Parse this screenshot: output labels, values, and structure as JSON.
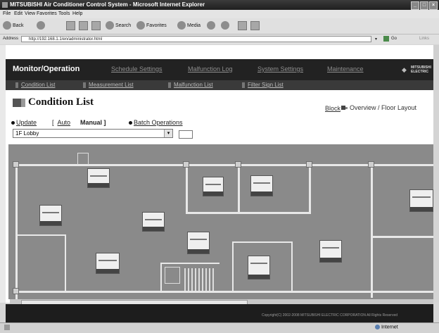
{
  "window": {
    "title": "MITSUBISHI Air Conditioner Control System - Microsoft Internet Explorer"
  },
  "menu": [
    "File",
    "Edit",
    "View",
    "Favorites",
    "Tools",
    "Help"
  ],
  "toolbar": {
    "back": "Back",
    "search": "Search",
    "favorites": "Favorites",
    "media": "Media"
  },
  "address": {
    "label": "Address",
    "url": "http://192.168.1.1/en/administrator.html",
    "go": "Go",
    "links": "Links"
  },
  "nav": {
    "active": "Monitor/Operation",
    "items": [
      "Schedule Settings",
      "Malfunction Log",
      "System Settings",
      "Maintenance"
    ],
    "sub": [
      "Condition List",
      "Measurement List",
      "Malfunction List",
      "Filter Sign List"
    ]
  },
  "logo": {
    "name": "MITSUBISHI ELECTRIC"
  },
  "page": {
    "title": "Condition List",
    "view_block": "Block",
    "view_overview": "Overview / Floor Layout",
    "update": "Update",
    "auto": "Auto",
    "manual": "Manual",
    "batch": "Batch Operations",
    "floor_select": "1F Lobby"
  },
  "footer": {
    "copyright": "Copyright(C) 2002-2008 MITSUBISHI ELECTRIC CORPORATION All Rights Reserved"
  },
  "status": {
    "zone": "Internet"
  },
  "colors": {
    "nav_bg": "#222222",
    "floor_bg": "#8a8a8a",
    "wall": "#e8e8e8"
  }
}
